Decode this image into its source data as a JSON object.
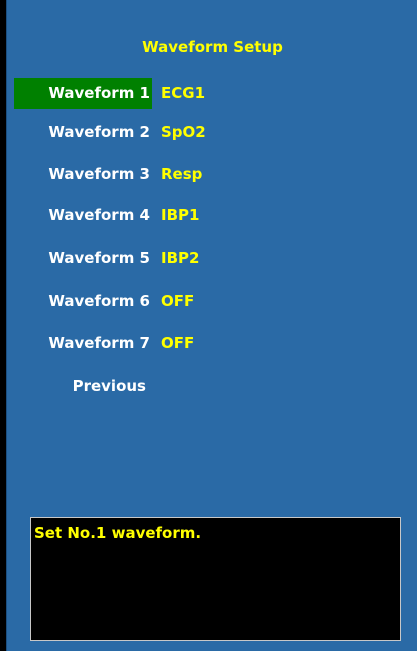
{
  "title": "Waveform Setup",
  "rows": [
    {
      "label": "Waveform 1",
      "value": "ECG1",
      "selected": true
    },
    {
      "label": "Waveform 2",
      "value": "SpO2",
      "selected": false
    },
    {
      "label": "Waveform 3",
      "value": "Resp",
      "selected": false
    },
    {
      "label": "Waveform 4",
      "value": "IBP1",
      "selected": false
    },
    {
      "label": "Waveform 5",
      "value": "IBP2",
      "selected": false
    },
    {
      "label": "Waveform 6",
      "value": "OFF",
      "selected": false
    },
    {
      "label": "Waveform 7",
      "value": "OFF",
      "selected": false
    }
  ],
  "previous_label": "Previous",
  "help_text": "Set No.1 waveform.",
  "colors": {
    "panel_bg": "#2a6aa6",
    "selected_bg": "#008000",
    "label_text": "#ffffff",
    "value_text": "#ffff00",
    "help_bg": "#000000"
  }
}
